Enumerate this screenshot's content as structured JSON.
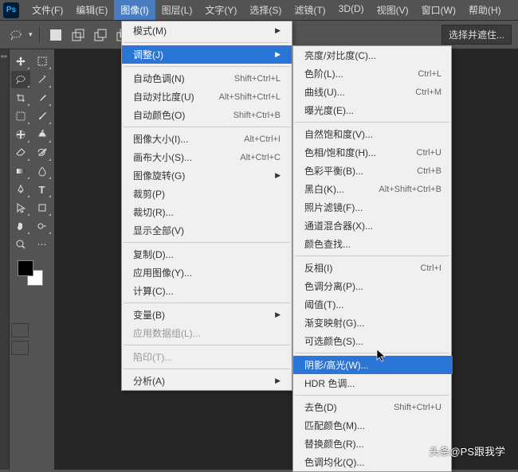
{
  "menubar": {
    "items": [
      "文件(F)",
      "编辑(E)",
      "图像(I)",
      "图层(L)",
      "文字(Y)",
      "选择(S)",
      "滤镜(T)",
      "3D(D)",
      "视图(V)",
      "窗口(W)",
      "帮助(H)"
    ],
    "active_index": 2
  },
  "toolbar": {
    "mask_label": "选择并遮住..."
  },
  "image_menu": {
    "rows": [
      {
        "label": "模式(M)",
        "arrow": true
      },
      {
        "sep": true
      },
      {
        "label": "调整(J)",
        "arrow": true,
        "hl": true
      },
      {
        "sep": true
      },
      {
        "label": "自动色调(N)",
        "shortcut": "Shift+Ctrl+L"
      },
      {
        "label": "自动对比度(U)",
        "shortcut": "Alt+Shift+Ctrl+L"
      },
      {
        "label": "自动颜色(O)",
        "shortcut": "Shift+Ctrl+B"
      },
      {
        "sep": true
      },
      {
        "label": "图像大小(I)...",
        "shortcut": "Alt+Ctrl+I"
      },
      {
        "label": "画布大小(S)...",
        "shortcut": "Alt+Ctrl+C"
      },
      {
        "label": "图像旋转(G)",
        "arrow": true
      },
      {
        "label": "裁剪(P)"
      },
      {
        "label": "裁切(R)..."
      },
      {
        "label": "显示全部(V)"
      },
      {
        "sep": true
      },
      {
        "label": "复制(D)..."
      },
      {
        "label": "应用图像(Y)..."
      },
      {
        "label": "计算(C)..."
      },
      {
        "sep": true
      },
      {
        "label": "变量(B)",
        "arrow": true
      },
      {
        "label": "应用数据组(L)...",
        "dis": true
      },
      {
        "sep": true
      },
      {
        "label": "陷印(T)...",
        "dis": true
      },
      {
        "sep": true
      },
      {
        "label": "分析(A)",
        "arrow": true
      }
    ]
  },
  "adjust_menu": {
    "rows": [
      {
        "label": "亮度/对比度(C)..."
      },
      {
        "label": "色阶(L)...",
        "shortcut": "Ctrl+L"
      },
      {
        "label": "曲线(U)...",
        "shortcut": "Ctrl+M"
      },
      {
        "label": "曝光度(E)..."
      },
      {
        "sep": true
      },
      {
        "label": "自然饱和度(V)..."
      },
      {
        "label": "色相/饱和度(H)...",
        "shortcut": "Ctrl+U"
      },
      {
        "label": "色彩平衡(B)...",
        "shortcut": "Ctrl+B"
      },
      {
        "label": "黑白(K)...",
        "shortcut": "Alt+Shift+Ctrl+B"
      },
      {
        "label": "照片滤镜(F)..."
      },
      {
        "label": "通道混合器(X)..."
      },
      {
        "label": "颜色查找..."
      },
      {
        "sep": true
      },
      {
        "label": "反相(I)",
        "shortcut": "Ctrl+I"
      },
      {
        "label": "色调分离(P)..."
      },
      {
        "label": "阈值(T)..."
      },
      {
        "label": "渐变映射(G)..."
      },
      {
        "label": "可选颜色(S)..."
      },
      {
        "sep": true
      },
      {
        "label": "阴影/高光(W)...",
        "hl": true
      },
      {
        "label": "HDR 色调..."
      },
      {
        "sep": true
      },
      {
        "label": "去色(D)",
        "shortcut": "Shift+Ctrl+U"
      },
      {
        "label": "匹配颜色(M)..."
      },
      {
        "label": "替换颜色(R)..."
      },
      {
        "label": "色调均化(Q)..."
      }
    ]
  },
  "watermark": "头条@PS跟我学"
}
